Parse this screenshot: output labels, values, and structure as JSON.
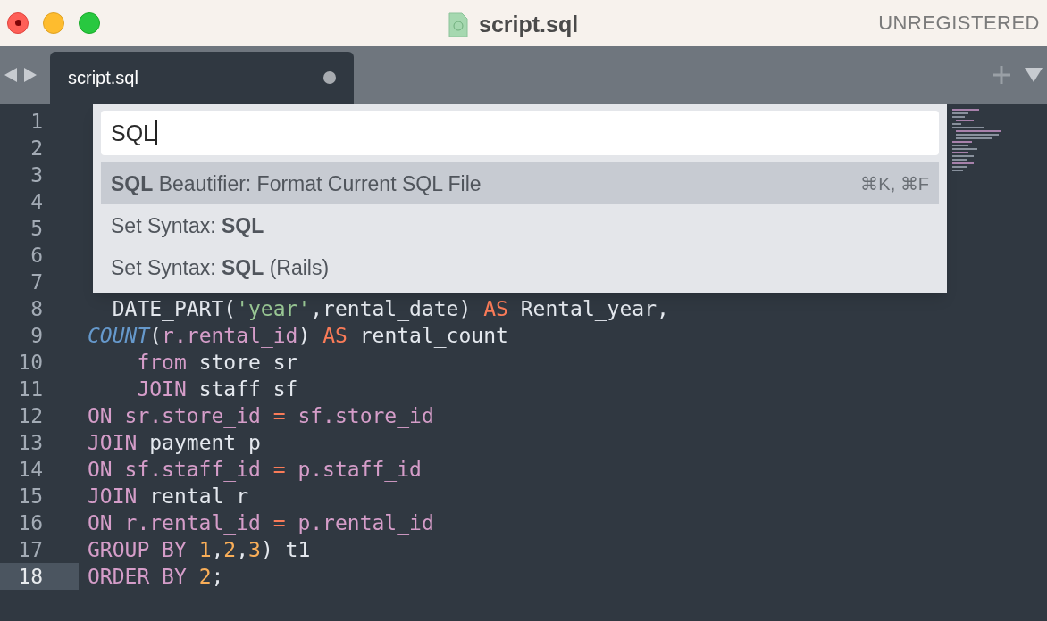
{
  "window": {
    "title": "script.sql",
    "registration": "UNREGISTERED"
  },
  "tabs": [
    {
      "label": "script.sql",
      "selected": true,
      "modified": true
    }
  ],
  "editor": {
    "lines": [
      {
        "number": "1",
        "current": false
      },
      {
        "number": "2",
        "current": false
      },
      {
        "number": "3",
        "current": false
      },
      {
        "number": "4",
        "current": false
      },
      {
        "number": "5",
        "current": false
      },
      {
        "number": "6",
        "current": false
      },
      {
        "number": "7",
        "current": false
      },
      {
        "number": "8",
        "current": false,
        "tokens": [
          {
            "text": "  DATE_PART(",
            "kind": "plain"
          },
          {
            "text": "'year'",
            "kind": "string"
          },
          {
            "text": ",rental_date) ",
            "kind": "plain"
          },
          {
            "text": "AS",
            "kind": "operator"
          },
          {
            "text": " Rental_year,",
            "kind": "plain"
          }
        ]
      },
      {
        "number": "9",
        "current": false,
        "tokens": [
          {
            "text": "COUNT",
            "kind": "function"
          },
          {
            "text": "(",
            "kind": "plain"
          },
          {
            "text": "r.rental_id",
            "kind": "keyword"
          },
          {
            "text": ") ",
            "kind": "plain"
          },
          {
            "text": "AS",
            "kind": "operator"
          },
          {
            "text": " rental_count",
            "kind": "plain"
          }
        ]
      },
      {
        "number": "10",
        "current": false,
        "tokens": [
          {
            "text": "    from",
            "kind": "keyword"
          },
          {
            "text": " store sr",
            "kind": "plain"
          }
        ]
      },
      {
        "number": "11",
        "current": false,
        "tokens": [
          {
            "text": "    JOIN",
            "kind": "keyword"
          },
          {
            "text": " staff sf",
            "kind": "plain"
          }
        ]
      },
      {
        "number": "12",
        "current": false,
        "tokens": [
          {
            "text": "ON sr.store_id ",
            "kind": "keyword"
          },
          {
            "text": "=",
            "kind": "operator"
          },
          {
            "text": " sf.store_id",
            "kind": "keyword"
          }
        ]
      },
      {
        "number": "13",
        "current": false,
        "tokens": [
          {
            "text": "JOIN",
            "kind": "keyword"
          },
          {
            "text": " payment p",
            "kind": "plain"
          }
        ]
      },
      {
        "number": "14",
        "current": false,
        "tokens": [
          {
            "text": "ON sf.staff_id ",
            "kind": "keyword"
          },
          {
            "text": "=",
            "kind": "operator"
          },
          {
            "text": " p.staff_id",
            "kind": "keyword"
          }
        ]
      },
      {
        "number": "15",
        "current": false,
        "tokens": [
          {
            "text": "JOIN",
            "kind": "keyword"
          },
          {
            "text": " rental r",
            "kind": "plain"
          }
        ]
      },
      {
        "number": "16",
        "current": false,
        "tokens": [
          {
            "text": "ON r.rental_id ",
            "kind": "keyword"
          },
          {
            "text": "=",
            "kind": "operator"
          },
          {
            "text": " p.rental_id",
            "kind": "keyword"
          }
        ]
      },
      {
        "number": "17",
        "current": false,
        "tokens": [
          {
            "text": "GROUP BY ",
            "kind": "keyword"
          },
          {
            "text": "1",
            "kind": "number"
          },
          {
            "text": ",",
            "kind": "plain"
          },
          {
            "text": "2",
            "kind": "number"
          },
          {
            "text": ",",
            "kind": "plain"
          },
          {
            "text": "3",
            "kind": "number"
          },
          {
            "text": ") t1",
            "kind": "plain"
          }
        ]
      },
      {
        "number": "18",
        "current": true,
        "tokens": [
          {
            "text": "ORDER BY ",
            "kind": "keyword"
          },
          {
            "text": "2",
            "kind": "number"
          },
          {
            "text": ";",
            "kind": "plain"
          }
        ]
      }
    ]
  },
  "command_palette": {
    "query": "SQL",
    "items": [
      {
        "text": "**SQL** Beautifier: Format Current SQL File",
        "shortcut": "⌘K, ⌘F",
        "selected": true
      },
      {
        "text": "Set Syntax: **SQL**",
        "selected": false
      },
      {
        "text": "Set Syntax: **SQL** (Rails)",
        "selected": false
      }
    ]
  }
}
